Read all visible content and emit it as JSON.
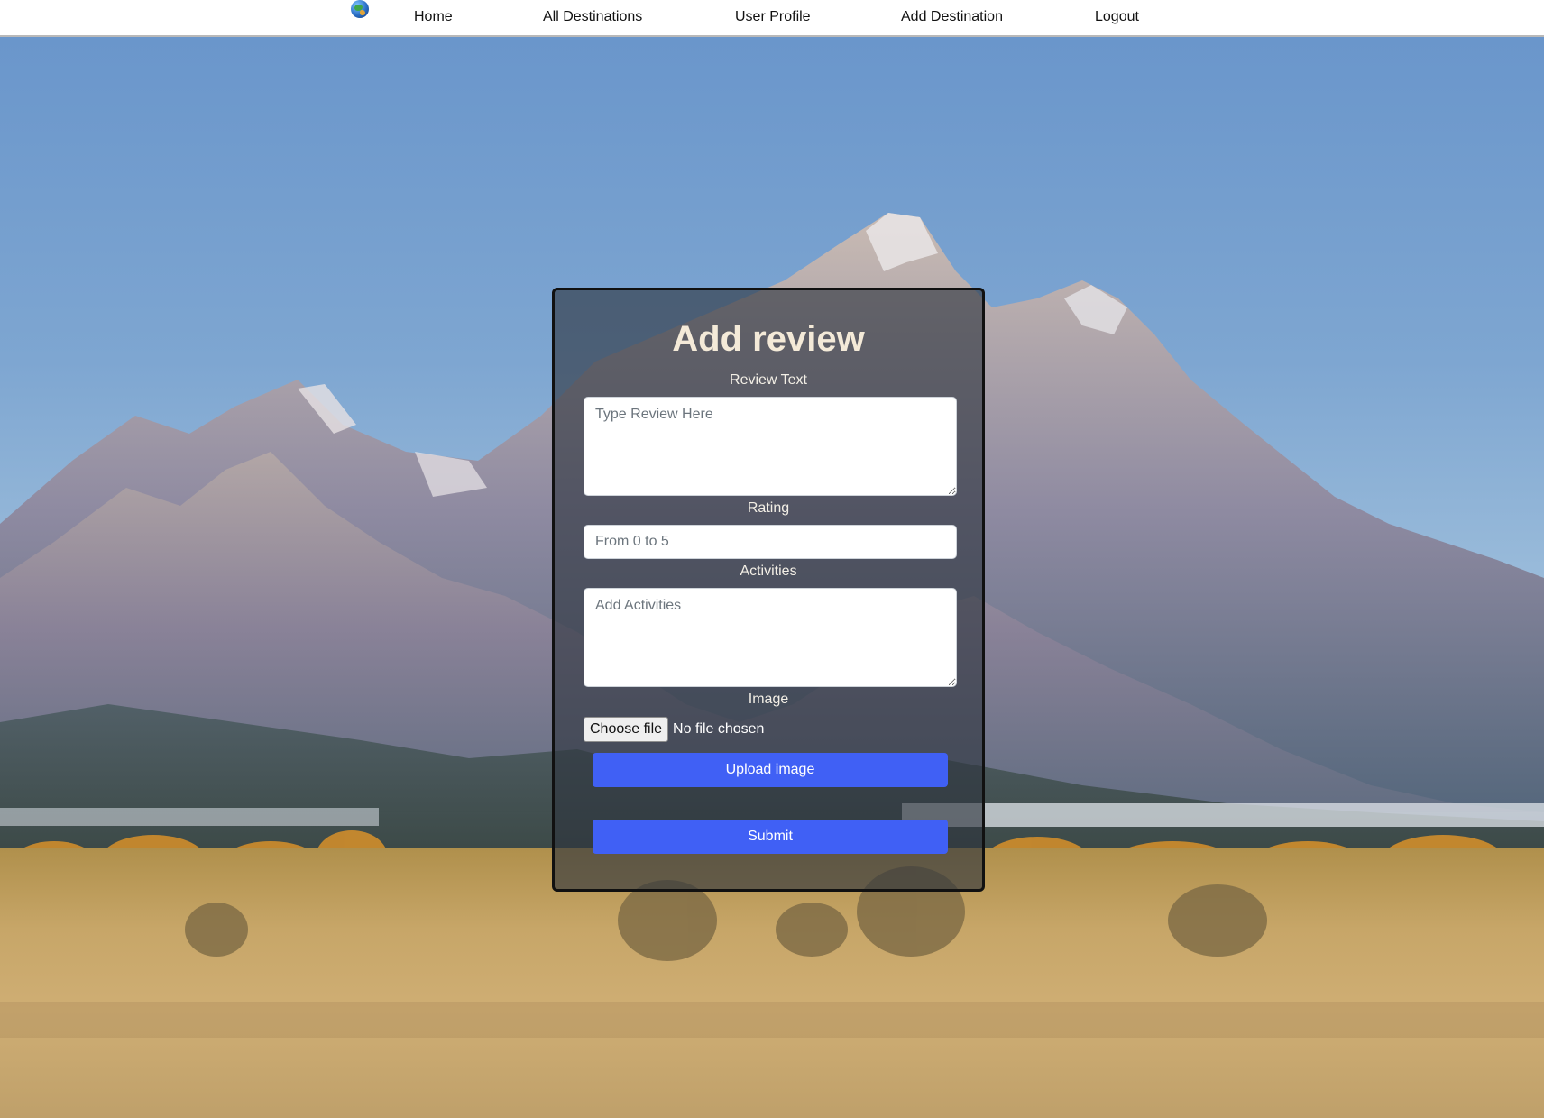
{
  "nav": {
    "logo_icon": "globe-icon",
    "items": [
      "Home",
      "All Destinations",
      "User Profile",
      "Add Destination",
      "Logout"
    ]
  },
  "form": {
    "title": "Add review",
    "review_label": "Review Text",
    "review_placeholder": "Type Review Here",
    "rating_label": "Rating",
    "rating_placeholder": "From 0 to 5",
    "activities_label": "Activities",
    "activities_placeholder": "Add Activities",
    "image_label": "Image",
    "file_button": "Choose file",
    "file_status": "No file chosen",
    "upload_button": "Upload image",
    "submit_button": "Submit"
  },
  "colors": {
    "button_blue": "#4060f5",
    "card_overlay": "rgba(45,52,62,0.62)",
    "title_color": "#f4ead8"
  }
}
